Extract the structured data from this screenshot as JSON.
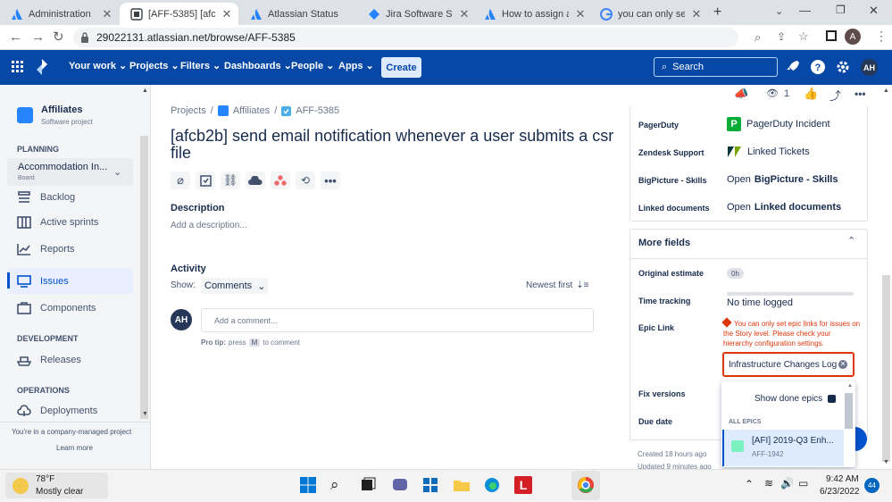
{
  "browser": {
    "tabs": [
      {
        "label": "Administration",
        "favicon": "atlassian-icon",
        "active": false
      },
      {
        "label": "[AFF-5385] [afcb2b]",
        "favicon": "jira-issue-icon",
        "active": true
      },
      {
        "label": "Atlassian Status",
        "favicon": "atlassian-icon",
        "active": false
      },
      {
        "label": "Jira Software Status",
        "favicon": "jira-icon",
        "active": false
      },
      {
        "label": "How to assign an e",
        "favicon": "atlassian-icon",
        "active": false
      },
      {
        "label": "you can only set ep",
        "favicon": "google-icon",
        "active": false
      }
    ],
    "url": "29022131.atlassian.net/browse/AFF-5385",
    "profile_initial": "A"
  },
  "topnav": {
    "items": [
      "Your work",
      "Projects",
      "Filters",
      "Dashboards",
      "People",
      "Apps"
    ],
    "create_label": "Create",
    "search_placeholder": "Search",
    "avatar_initials": "AH"
  },
  "sidebar": {
    "project_name": "Affiliates",
    "project_type": "Software project",
    "planning_label": "PLANNING",
    "board_name": "Accommodation In...",
    "board_sub": "Board",
    "planning_items": [
      "Backlog",
      "Active sprints",
      "Reports"
    ],
    "issues_label": "Issues",
    "components_label": "Components",
    "development_label": "DEVELOPMENT",
    "releases_label": "Releases",
    "operations_label": "OPERATIONS",
    "deployments_label": "Deployments",
    "footer_text": "You're in a company-managed project",
    "learn_more": "Learn more"
  },
  "issue": {
    "breadcrumb": [
      "Projects",
      "Affiliates",
      "AFF-5385"
    ],
    "title": "[afcb2b] send email notification whenever a user submits a csr file",
    "description_label": "Description",
    "description_placeholder": "Add a description...",
    "activity_label": "Activity",
    "show_label": "Show:",
    "show_value": "Comments",
    "sort_label": "Newest first",
    "commenter_initials": "AH",
    "comment_placeholder": "Add a comment...",
    "protip_prefix": "Pro tip:",
    "protip_press": "press",
    "protip_key": "M",
    "protip_suffix": "to comment"
  },
  "rightpanel": {
    "watch_count": "1",
    "fields": [
      {
        "label": "PagerDuty",
        "value": "PagerDuty Incident"
      },
      {
        "label": "Zendesk Support",
        "value": "Linked Tickets"
      },
      {
        "label": "BigPicture - Skills",
        "value_prefix": "Open",
        "value": "BigPicture - Skills"
      },
      {
        "label": "Linked documents",
        "value_prefix": "Open",
        "value": "Linked documents"
      }
    ],
    "more_fields_label": "More fields",
    "original_estimate_label": "Original estimate",
    "original_estimate_value": "0h",
    "time_tracking_label": "Time tracking",
    "time_tracking_value": "No time logged",
    "epic_link_label": "Epic Link",
    "epic_error": "You can only set epic links for issues on the Story level. Please check your hierarchy configuration settings.",
    "epic_input_value": "Infrastructure Changes Log",
    "fix_versions_label": "Fix versions",
    "due_date_label": "Due date",
    "created_text": "Created 18 hours ago",
    "updated_text": "Updated 9 minutes ago",
    "dropdown": {
      "show_done_label": "Show done epics",
      "section_label": "ALL EPICS",
      "epic_name": "[AFI] 2019-Q3 Enh...",
      "epic_key": "AFF-1942"
    }
  },
  "taskbar": {
    "weather_temp": "78°F",
    "weather_desc": "Mostly clear",
    "time": "9:42 AM",
    "date": "6/23/2022",
    "notification_count": "44"
  },
  "colors": {
    "jira_blue": "#0747a6",
    "accent": "#0052cc",
    "error": "#de350b",
    "epic_chip": "#79f2c0"
  }
}
